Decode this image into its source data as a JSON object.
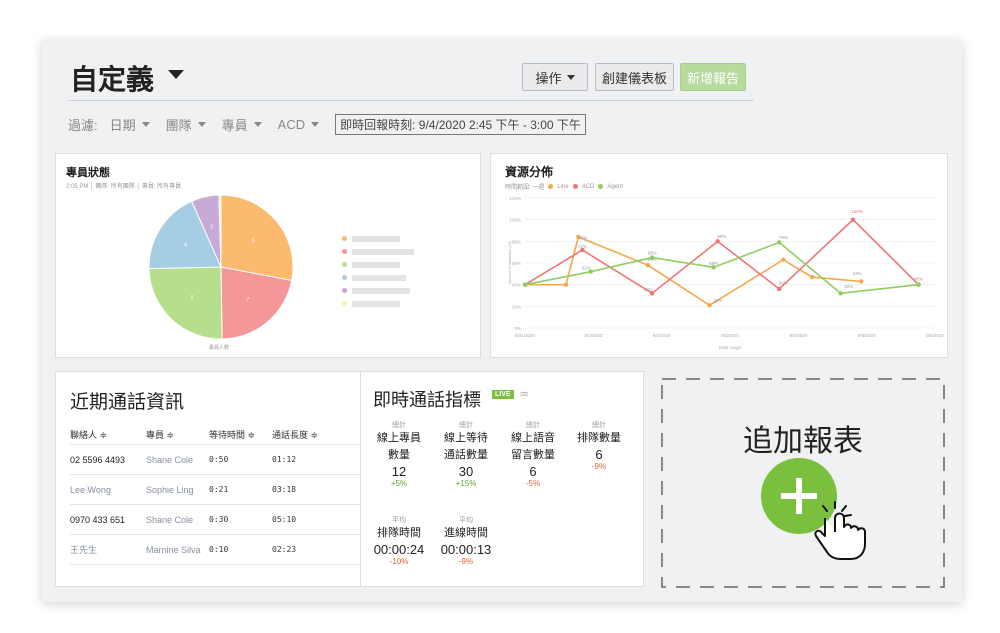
{
  "header": {
    "title": "自定義",
    "actions_label": "操作",
    "create_dashboard_label": "創建儀表板",
    "new_report_label": "新增報告"
  },
  "filters": {
    "label": "過濾:",
    "items": [
      "日期",
      "團隊",
      "專員",
      "ACD"
    ],
    "realtime_label": "即時回報時刻: 9/4/2020 2:45 下午 - 3:00 下午"
  },
  "agent_status": {
    "title": "專員狀態",
    "subtitle": "2:05 PM │ 團隊: 所有團隊 │ 專員: 所有專員",
    "caption": "專員人數",
    "slices": [
      {
        "value": 9,
        "label": "9",
        "color": "#fbba6d"
      },
      {
        "value": 7,
        "label": "7",
        "color": "#f59698"
      },
      {
        "value": 8,
        "label": "8",
        "color": "#b5de8d"
      },
      {
        "value": 6,
        "label": "6",
        "color": "#a5cde3"
      },
      {
        "value": 2,
        "label": "2",
        "color": "#c9a9d6"
      },
      {
        "value": 0.15,
        "label": "",
        "color": "#f8f4a3"
      }
    ],
    "legend_colors": [
      "#fbba6d",
      "#f59698",
      "#b5de8d",
      "#a5cde3",
      "#c9a9d6",
      "#f8f4a3"
    ]
  },
  "resource": {
    "title": "資源分佈",
    "range_label": "時間範圍: 一週",
    "legend": [
      {
        "name": "Line",
        "color": "#f5a74e"
      },
      {
        "name": "ACD",
        "color": "#ef7675"
      },
      {
        "name": "Agent",
        "color": "#8fce5e"
      }
    ],
    "ylabel": "Amount of utilization (%)",
    "xlabel": "Date range"
  },
  "chart_data": {
    "type": "line",
    "x": [
      "8/31/2020",
      "9/1/2020",
      "9/2/2020",
      "9/3/2020",
      "9/4/2020",
      "9/5/2020",
      "9/6/2020"
    ],
    "y_ticks": [
      "0%",
      "20%",
      "40%",
      "60%",
      "80%",
      "100%",
      "120%"
    ],
    "ylim": [
      0,
      120
    ],
    "x_positions": [
      0,
      0.5,
      1,
      2,
      3,
      4,
      4.5,
      5,
      6,
      7,
      7.5,
      8,
      9,
      10
    ],
    "series": [
      {
        "name": "Line",
        "color": "#f5a74e",
        "values": [
          40,
          40,
          40,
          84,
          70,
          58,
          21,
          63,
          43,
          43,
          null,
          null,
          null,
          null
        ],
        "points": [
          [
            0,
            40
          ],
          [
            1,
            40
          ],
          [
            1.3,
            84
          ],
          [
            3,
            58
          ],
          [
            4.5,
            21
          ],
          [
            6.3,
            63
          ],
          [
            7,
            47
          ],
          [
            8.2,
            43
          ]
        ]
      },
      {
        "name": "ACD",
        "color": "#ef7675",
        "points": [
          [
            0,
            40
          ],
          [
            1.4,
            72
          ],
          [
            3.1,
            32
          ],
          [
            4.7,
            80
          ],
          [
            6.2,
            36
          ],
          [
            8,
            100
          ],
          [
            9.6,
            40
          ]
        ]
      },
      {
        "name": "Agent",
        "color": "#8fce5e",
        "points": [
          [
            0,
            40
          ],
          [
            1.6,
            52
          ],
          [
            3.1,
            65
          ],
          [
            4.6,
            56
          ],
          [
            6.2,
            79
          ],
          [
            7.7,
            32
          ],
          [
            9.6,
            40
          ]
        ]
      }
    ],
    "data_labels": [
      {
        "x": 1.4,
        "y": 82,
        "text": "82%"
      },
      {
        "x": 1.4,
        "y": 74,
        "text": "72%"
      },
      {
        "x": 1.5,
        "y": 54,
        "text": "52%"
      },
      {
        "x": 3.1,
        "y": 68,
        "text": "68%"
      },
      {
        "x": 3.1,
        "y": 62,
        "text": "65%"
      },
      {
        "x": 3.0,
        "y": 34,
        "text": "32%"
      },
      {
        "x": 4.8,
        "y": 83,
        "text": "80%"
      },
      {
        "x": 4.6,
        "y": 58,
        "text": "58%"
      },
      {
        "x": 4.7,
        "y": 24,
        "text": "21%"
      },
      {
        "x": 6.3,
        "y": 82,
        "text": "79%"
      },
      {
        "x": 6.3,
        "y": 40,
        "text": "36%"
      },
      {
        "x": 8.1,
        "y": 106,
        "text": "100%"
      },
      {
        "x": 8.1,
        "y": 49,
        "text": "43%"
      },
      {
        "x": 7.9,
        "y": 37,
        "text": "32%"
      },
      {
        "x": 9.6,
        "y": 44,
        "text": "40%"
      }
    ]
  },
  "recent_calls": {
    "title": "近期通話資訊",
    "headers": [
      "聯絡人 ≑",
      "專員 ≑",
      "等待時間 ≑",
      "通話長度 ≑"
    ],
    "rows": [
      {
        "contact": "02 5596 4493",
        "agent": "Shane Cole",
        "wait": "0:50",
        "length": "01:12",
        "style": "dark"
      },
      {
        "contact": "Lee Wong",
        "agent": "Sophie Ling",
        "wait": "0:21",
        "length": "03:18",
        "style": "light"
      },
      {
        "contact": "0970 433 651",
        "agent": "Shane Cole",
        "wait": "0:30",
        "length": "05:10",
        "style": "dark"
      },
      {
        "contact": "王先生",
        "agent": "Marnine Silva",
        "wait": "0:10",
        "length": "02:23",
        "style": "light"
      }
    ]
  },
  "realtime": {
    "title": "即時通話指標",
    "live_badge": "LIVE",
    "metrics": [
      {
        "kind": "總計",
        "name1": "線上專員",
        "name2": "數量",
        "value": "12",
        "delta": "+5%",
        "dir": "up"
      },
      {
        "kind": "總計",
        "name1": "線上等待",
        "name2": "通話數量",
        "value": "30",
        "delta": "+15%",
        "dir": "up"
      },
      {
        "kind": "總計",
        "name1": "線上語音",
        "name2": "留言數量",
        "value": "6",
        "delta": "-5%",
        "dir": "down"
      },
      {
        "kind": "總計",
        "name1": "排隊數量",
        "name2": "",
        "value": "6",
        "delta": "-9%",
        "dir": "down"
      },
      {
        "kind": "平均",
        "name1": "排隊時間",
        "name2": "",
        "value": "00:00:24",
        "delta": "-10%",
        "dir": "down"
      },
      {
        "kind": "平均",
        "name1": "進線時間",
        "name2": "",
        "value": "00:00:13",
        "delta": "-9%",
        "dir": "down"
      }
    ]
  },
  "add_report": {
    "title": "追加報表",
    "icon": "plus-icon",
    "accent": "#7bbf3e"
  }
}
